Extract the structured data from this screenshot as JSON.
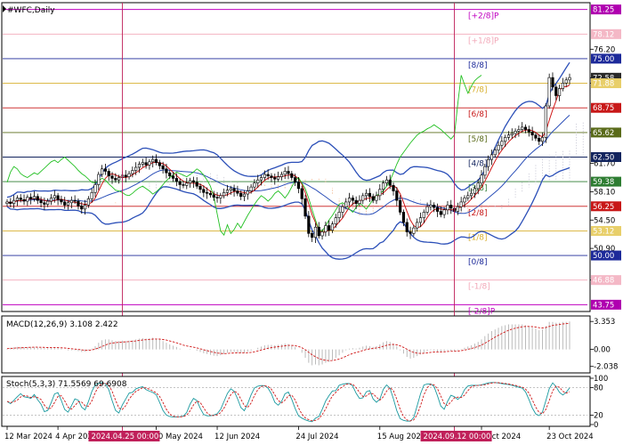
{
  "chart_data": {
    "type": "candlestick",
    "symbol_label": "#WFC,Daily",
    "price_axis": {
      "ticks": [
        "76.20",
        "72.58",
        "71.88",
        "65.62",
        "61.70",
        "58.10",
        "54.50",
        "50.90",
        "46.88"
      ],
      "range": [
        43.0,
        82.0
      ]
    },
    "price_badges": [
      {
        "value": 81.25,
        "text": "81.25",
        "color": "#b000b0"
      },
      {
        "value": 78.12,
        "text": "78.12",
        "color": "#f4b8c6"
      },
      {
        "value": 75.0,
        "text": "75.00",
        "color": "#1d2a9a"
      },
      {
        "value": 72.58,
        "text": "72.58",
        "color": "#2a2a2a"
      },
      {
        "value": 71.88,
        "text": "71.88",
        "color": "#e8cf6a"
      },
      {
        "value": 68.75,
        "text": "68.75",
        "color": "#c81818"
      },
      {
        "value": 65.62,
        "text": "65.62",
        "color": "#5a6b1a"
      },
      {
        "value": 62.5,
        "text": "62.50",
        "color": "#12245e"
      },
      {
        "value": 59.38,
        "text": "59.38",
        "color": "#2e7d32"
      },
      {
        "value": 56.25,
        "text": "56.25",
        "color": "#c81818"
      },
      {
        "value": 53.12,
        "text": "53.12",
        "color": "#e8cf6a"
      },
      {
        "value": 50.0,
        "text": "50.00",
        "color": "#1d2a9a"
      },
      {
        "value": 46.88,
        "text": "46.88",
        "color": "#f4b8c6"
      },
      {
        "value": 43.75,
        "text": "43.75",
        "color": "#b000b0"
      }
    ],
    "murrey_lines": [
      {
        "label": "[+2/8]P",
        "value": 81.25,
        "color": "#c000c0"
      },
      {
        "label": "[+1/8]P",
        "value": 78.12,
        "color": "#f2a8b8"
      },
      {
        "label": "[8/8]",
        "value": 75.0,
        "color": "#1d2a9a"
      },
      {
        "label": "[7/8]",
        "value": 71.88,
        "color": "#d8b030"
      },
      {
        "label": "[6/8]",
        "value": 68.75,
        "color": "#c81818"
      },
      {
        "label": "[5/8]",
        "value": 65.62,
        "color": "#5a6b1a"
      },
      {
        "label": "[4/8]",
        "value": 62.5,
        "color": "#12245e"
      },
      {
        "label": "[3/8]",
        "value": 59.38,
        "color": "#2e7d32"
      },
      {
        "label": "[2/8]",
        "value": 56.25,
        "color": "#c81818"
      },
      {
        "label": "[1/8]",
        "value": 53.12,
        "color": "#d8b030"
      },
      {
        "label": "[0/8]",
        "value": 50.0,
        "color": "#1d2a9a"
      },
      {
        "label": "[-1/8]",
        "value": 46.88,
        "color": "#f2a8b8"
      },
      {
        "label": "[-2/8]P",
        "value": 43.75,
        "color": "#c000c0"
      }
    ],
    "closes": [
      56.8,
      56.6,
      57.0,
      57.3,
      57.1,
      56.9,
      57.4,
      57.2,
      57.5,
      57.0,
      56.7,
      56.5,
      56.9,
      57.3,
      57.6,
      57.1,
      56.8,
      56.4,
      56.7,
      57.0,
      56.9,
      56.3,
      55.9,
      56.4,
      57.2,
      58.0,
      59.0,
      60.3,
      61.0,
      60.7,
      60.1,
      59.8,
      59.6,
      59.9,
      60.2,
      60.0,
      60.4,
      60.8,
      61.2,
      61.6,
      61.8,
      61.5,
      61.9,
      62.2,
      61.8,
      61.4,
      61.0,
      60.5,
      60.1,
      59.8,
      59.4,
      59.0,
      58.9,
      59.2,
      59.5,
      59.3,
      58.8,
      58.4,
      58.0,
      57.9,
      57.7,
      57.4,
      57.3,
      57.6,
      58.0,
      58.3,
      58.5,
      58.2,
      57.9,
      57.5,
      57.8,
      58.2,
      58.7,
      59.2,
      59.6,
      59.9,
      60.3,
      60.1,
      59.9,
      59.7,
      60.0,
      60.3,
      60.7,
      60.4,
      59.9,
      59.3,
      58.5,
      57.2,
      55.0,
      52.8,
      52.3,
      53.6,
      52.5,
      53.0,
      53.8,
      53.2,
      54.0,
      54.8,
      55.5,
      56.2,
      56.8,
      57.3,
      57.0,
      56.6,
      57.0,
      57.6,
      57.9,
      57.5,
      57.0,
      57.6,
      58.4,
      59.2,
      59.6,
      58.9,
      58.2,
      57.0,
      55.5,
      54.2,
      53.0,
      52.8,
      53.5,
      54.2,
      54.8,
      55.5,
      56.2,
      56.4,
      56.1,
      55.6,
      55.2,
      55.8,
      56.4,
      56.0,
      55.6,
      56.2,
      56.8,
      57.3,
      57.6,
      57.9,
      58.5,
      59.2,
      60.2,
      61.3,
      62.2,
      62.8,
      63.4,
      64.0,
      64.5,
      65.0,
      65.3,
      65.5,
      65.8,
      66.0,
      66.3,
      66.0,
      65.7,
      65.3,
      64.9,
      64.5,
      65.0,
      69.0,
      72.6,
      71.4,
      70.3,
      71.2,
      71.9,
      72.3,
      72.6
    ],
    "dates_axis": [
      "12 Mar 2024",
      "4 Apr 2024",
      "20 May 2024",
      "12 Jun 2024",
      "24 Jul 2024",
      "15 Aug 2024",
      "1 Oct 2024",
      "23 Oct 2024"
    ],
    "date_markers": [
      "2024.04.25 00:00",
      "2024.09.12 00:00"
    ],
    "macd": {
      "label": "MACD(12,26,9) 3.108 2.422",
      "axis_ticks": [
        "3.353",
        "0.00",
        "-2.038"
      ],
      "range": [
        -2.6,
        3.8
      ],
      "histogram": [
        0.1,
        0.2,
        0.25,
        0.3,
        0.3,
        0.25,
        0.3,
        0.3,
        0.3,
        0.25,
        0.2,
        0.15,
        0.15,
        0.2,
        0.25,
        0.2,
        0.1,
        0.0,
        -0.1,
        -0.1,
        -0.1,
        -0.2,
        -0.3,
        -0.25,
        -0.1,
        0.1,
        0.4,
        0.8,
        1.1,
        1.2,
        1.2,
        1.1,
        1.0,
        1.0,
        1.05,
        1.0,
        1.05,
        1.1,
        1.2,
        1.3,
        1.35,
        1.3,
        1.35,
        1.4,
        1.3,
        1.2,
        1.0,
        0.8,
        0.6,
        0.45,
        0.3,
        0.1,
        0.0,
        0.0,
        0.05,
        0.0,
        -0.15,
        -0.3,
        -0.45,
        -0.55,
        -0.65,
        -0.75,
        -0.8,
        -0.7,
        -0.55,
        -0.4,
        -0.3,
        -0.3,
        -0.35,
        -0.45,
        -0.4,
        -0.3,
        -0.15,
        0.0,
        0.2,
        0.35,
        0.5,
        0.55,
        0.55,
        0.5,
        0.55,
        0.6,
        0.7,
        0.65,
        0.5,
        0.3,
        0.0,
        -0.4,
        -1.0,
        -1.6,
        -1.9,
        -1.8,
        -1.9,
        -1.8,
        -1.6,
        -1.5,
        -1.3,
        -1.0,
        -0.7,
        -0.4,
        -0.1,
        0.1,
        0.15,
        0.1,
        0.2,
        0.35,
        0.45,
        0.4,
        0.3,
        0.4,
        0.6,
        0.85,
        1.0,
        0.9,
        0.7,
        0.4,
        -0.1,
        -0.5,
        -0.9,
        -1.1,
        -1.0,
        -0.8,
        -0.6,
        -0.4,
        -0.2,
        -0.1,
        -0.15,
        -0.25,
        -0.3,
        -0.2,
        -0.1,
        -0.15,
        -0.2,
        -0.1,
        0.05,
        0.2,
        0.35,
        0.5,
        0.7,
        0.9,
        1.2,
        1.6,
        1.9,
        2.2,
        2.4,
        2.6,
        2.8,
        2.9,
        3.0,
        3.0,
        3.0,
        3.0,
        3.0,
        2.9,
        2.8,
        2.6,
        2.5,
        2.3,
        2.4,
        2.8,
        3.3,
        3.3,
        3.2,
        3.2,
        3.3,
        3.3,
        3.35
      ],
      "signal": [
        0.1,
        0.12,
        0.15,
        0.18,
        0.2,
        0.22,
        0.24,
        0.26,
        0.27,
        0.27,
        0.26,
        0.25,
        0.23,
        0.22,
        0.22,
        0.22,
        0.2,
        0.17,
        0.13,
        0.09,
        0.05,
        0.0,
        -0.05,
        -0.1,
        -0.1,
        -0.06,
        0.03,
        0.18,
        0.36,
        0.53,
        0.67,
        0.76,
        0.81,
        0.85,
        0.89,
        0.91,
        0.94,
        0.97,
        1.02,
        1.08,
        1.13,
        1.17,
        1.2,
        1.24,
        1.25,
        1.24,
        1.19,
        1.12,
        1.02,
        0.91,
        0.79,
        0.65,
        0.52,
        0.42,
        0.34,
        0.27,
        0.18,
        0.08,
        -0.03,
        -0.14,
        -0.24,
        -0.34,
        -0.43,
        -0.48,
        -0.5,
        -0.48,
        -0.45,
        -0.42,
        -0.41,
        -0.42,
        -0.42,
        -0.4,
        -0.35,
        -0.28,
        -0.18,
        -0.07,
        0.04,
        0.14,
        0.22,
        0.28,
        0.33,
        0.38,
        0.44,
        0.48,
        0.48,
        0.45,
        0.36,
        0.21,
        -0.03,
        -0.34,
        -0.65,
        -0.88,
        -1.08,
        -1.22,
        -1.3,
        -1.34,
        -1.33,
        -1.26,
        -1.15,
        -1.0,
        -0.82,
        -0.64,
        -0.48,
        -0.36,
        -0.25,
        -0.13,
        -0.01,
        0.07,
        0.12,
        0.18,
        0.26,
        0.38,
        0.5,
        0.58,
        0.6,
        0.56,
        0.43,
        0.25,
        0.02,
        -0.2,
        -0.36,
        -0.45,
        -0.48,
        -0.46,
        -0.41,
        -0.35,
        -0.31,
        -0.3,
        -0.3,
        -0.28,
        -0.24,
        -0.22,
        -0.22,
        -0.2,
        -0.15,
        -0.08,
        0.01,
        0.11,
        0.23,
        0.36,
        0.53,
        0.74,
        0.98,
        1.23,
        1.47,
        1.7,
        1.92,
        2.12,
        2.3,
        2.44,
        2.55,
        2.64,
        2.71,
        2.75,
        2.76,
        2.73,
        2.69,
        2.61,
        2.57,
        2.62,
        2.76,
        2.87,
        2.94,
        2.99,
        3.05,
        3.1,
        3.108
      ]
    },
    "stoch": {
      "label": "Stoch(5,3,3) 71.5569 69.6908",
      "axis_ticks": [
        "100",
        "80",
        "20",
        "0"
      ],
      "range": [
        0,
        100
      ]
    }
  }
}
